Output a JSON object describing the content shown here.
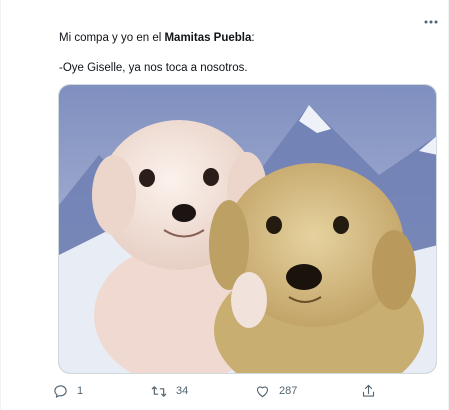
{
  "tweet": {
    "text_prefix": "Mi compa y yo en el ",
    "text_bold": "Mamitas Puebla",
    "text_suffix": ":",
    "text_line2": "-Oye Giselle, ya nos toca a nosotros."
  },
  "media": {
    "description_icon": "photo-two-puppies",
    "colors": {
      "sky": "#9aa6cc",
      "snow": "#e8ecf5",
      "puppy_left": "#f3e6df",
      "puppy_right": "#d8c08a"
    }
  },
  "actions": {
    "reply_count": "1",
    "retweet_count": "34",
    "like_count": "287",
    "icons": [
      "reply-icon",
      "retweet-icon",
      "like-icon",
      "share-icon"
    ]
  },
  "colors": {
    "text": "#0f1419",
    "muted": "#536471",
    "border": "#cfd9de"
  }
}
